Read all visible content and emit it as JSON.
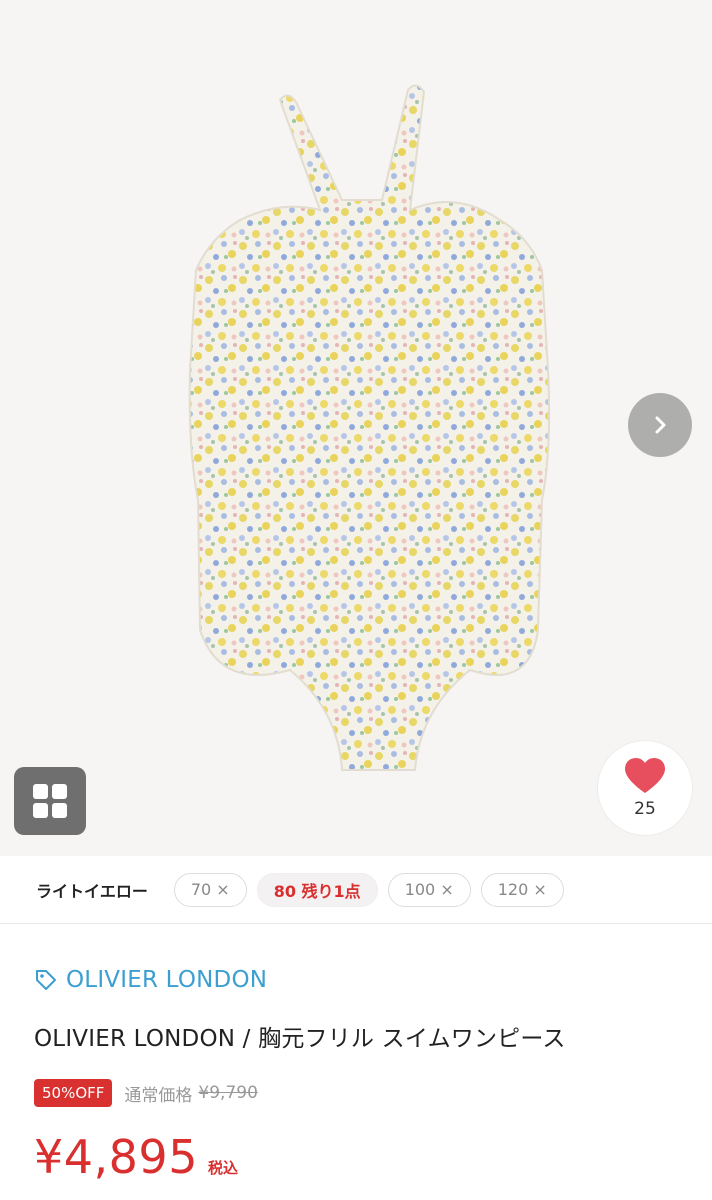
{
  "product": {
    "favorite_count": "25"
  },
  "variants": {
    "color_label": "ライトイエロー",
    "sizes": [
      "70 ×",
      "80 残り1点",
      "100 ×",
      "120 ×"
    ]
  },
  "info": {
    "brand": "OLIVIER LONDON",
    "title": "OLIVIER LONDON / 胸元フリル スイムワンピース",
    "discount_badge": "50%OFF",
    "regular_label": "通常価格",
    "regular_price": "¥9,790",
    "sale_price": "¥4,895",
    "tax_label": "税込"
  },
  "colors": {
    "accent_red": "#d9302f",
    "brand_blue": "#3c9fd1",
    "heart_pink": "#e84f5e"
  },
  "icons": {
    "next": "chevron-right-icon",
    "grid": "grid-icon",
    "favorite": "heart-icon",
    "brand": "tag-icon"
  }
}
